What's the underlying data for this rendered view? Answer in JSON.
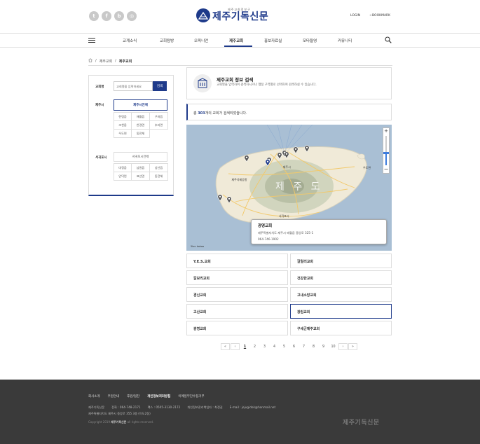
{
  "header": {
    "socials": [
      {
        "icon": "twitter-icon",
        "glyph": "t"
      },
      {
        "icon": "facebook-icon",
        "glyph": "f"
      },
      {
        "icon": "blog-icon",
        "glyph": "b"
      },
      {
        "icon": "instagram-icon",
        "glyph": "◎"
      }
    ],
    "logo_sub": "제주교회정보구",
    "logo_main": "제주기독신문",
    "login": "LOGIN",
    "bookmark": "☆BOOKMARK"
  },
  "nav": {
    "items": [
      {
        "label": "교계소식",
        "active": false
      },
      {
        "label": "교회탐방",
        "active": false
      },
      {
        "label": "오피니언",
        "active": false
      },
      {
        "label": "제주교회",
        "active": true
      },
      {
        "label": "홍보자료실",
        "active": false
      },
      {
        "label": "모타들영",
        "active": false
      },
      {
        "label": "커뮤니티",
        "active": false
      }
    ]
  },
  "breadcrumb": {
    "sep": "/",
    "items": [
      "제주교회",
      "제주교회"
    ]
  },
  "sidebar": {
    "name_label": "교회명",
    "name_placeholder": "교회명을 입력하세요",
    "search_btn": "검색",
    "jeju_label": "제주시",
    "jeju_all": "제주시전체",
    "jeju_areas": [
      "한림읍",
      "애월읍",
      "구좌읍",
      "조천읍",
      "한경면",
      "추자면",
      "우도면",
      "동전체"
    ],
    "seogwipo_label": "서귀포시",
    "seogwipo_all": "서귀포시전체",
    "seogwipo_areas": [
      "대정읍",
      "남원읍",
      "성산읍",
      "안덕면",
      "표선면",
      "동전체"
    ]
  },
  "info": {
    "title": "제주교회 정보 검색",
    "desc": "교회명을 입력하여 검색하시거나 행정 구역별로 선택하여 검색하실 수 있습니다."
  },
  "count": {
    "prefix": "총 ",
    "num": "303",
    "suffix": "개의 교회가 검색되었습니다."
  },
  "map": {
    "big_label": "제 주 도",
    "places": [
      {
        "text": "제주시",
        "x": "0.47",
        "y": "0.32"
      },
      {
        "text": "서귀포시",
        "x": "0.45",
        "y": "0.71"
      },
      {
        "text": "우도면",
        "x": "0.86",
        "y": "0.33"
      },
      {
        "text": "제주국제공항",
        "x": "0.22",
        "y": "0.42"
      }
    ],
    "popup_name": "광명교회",
    "popup_addr": "제주특별자치도 제주시 애월읍 중앙로 325-1",
    "popup_tel": "064-746-1902",
    "scale": "5km  kakao"
  },
  "results": [
    {
      "name": "Y.E.S.교회",
      "selected": false
    },
    {
      "name": "갈릴리교회",
      "selected": false
    },
    {
      "name": "갈보리교회",
      "selected": false
    },
    {
      "name": "건강한교회",
      "selected": false
    },
    {
      "name": "경신교회",
      "selected": false
    },
    {
      "name": "고내소망교회",
      "selected": false
    },
    {
      "name": "고산교회",
      "selected": false
    },
    {
      "name": "광림교회",
      "selected": true
    },
    {
      "name": "광명교회",
      "selected": false
    },
    {
      "name": "구세군제주교회",
      "selected": false
    }
  ],
  "pagination": {
    "first": "«",
    "prev": "‹",
    "pages": [
      "1",
      "2",
      "3",
      "4",
      "5",
      "6",
      "7",
      "8",
      "9",
      "10"
    ],
    "current": "1",
    "next": "›",
    "last": "»"
  },
  "footer": {
    "menu": [
      {
        "label": "회사소개",
        "bold": false
      },
      {
        "label": "주원안내",
        "bold": false
      },
      {
        "label": "후원/협찬",
        "bold": false
      },
      {
        "label": "개인정보처리방침",
        "bold": true
      },
      {
        "label": "이메일무단수집거부",
        "bold": false
      }
    ],
    "line1": [
      "제주기독신문",
      "전화 : 064-748-2171",
      "팩스 : 0505-3130-2172",
      "개인정보관리책임자 : 최정길",
      "E-mail : jejugidok@hanmail.net"
    ],
    "line2": [
      "제주특별자치도 제주시 중앙로 355 3층 (이도2동)"
    ],
    "copy_prefix": "Copyright 2019 ",
    "copy_brand": "제주기독신문",
    "copy_suffix": " all rights reserved.",
    "logo": "제주기독신문"
  }
}
